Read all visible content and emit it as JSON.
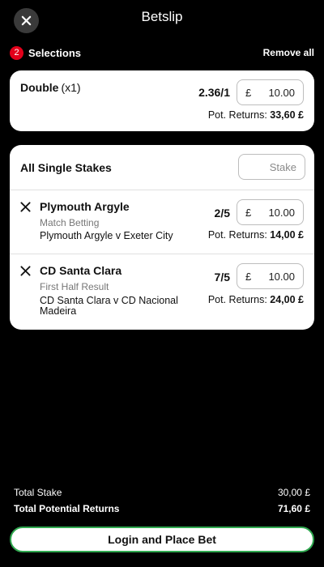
{
  "header": {
    "title": "Betslip",
    "close_icon": "close-icon"
  },
  "selections_bar": {
    "count": "2",
    "label": "Selections",
    "remove_all": "Remove all"
  },
  "double": {
    "label": "Double",
    "multiplier": "(x1)",
    "odds": "2.36/1",
    "currency": "£",
    "stake": "10.00",
    "returns_label": "Pot. Returns:",
    "returns_value": "33,60 £"
  },
  "singles": {
    "all_label": "All Single Stakes",
    "stake_placeholder": "Stake",
    "items": [
      {
        "team": "Plymouth Argyle",
        "market": "Match Betting",
        "event": "Plymouth Argyle v Exeter City",
        "odds": "2/5",
        "currency": "£",
        "stake": "10.00",
        "returns_label": "Pot. Returns:",
        "returns_value": "14,00 £"
      },
      {
        "team": "CD Santa Clara",
        "market": "First Half Result",
        "event": "CD Santa Clara v CD Nacional Madeira",
        "odds": "7/5",
        "currency": "£",
        "stake": "10.00",
        "returns_label": "Pot. Returns:",
        "returns_value": "24,00 £"
      }
    ]
  },
  "totals": {
    "stake_label": "Total Stake",
    "stake_value": "30,00 £",
    "returns_label": "Total Potential Returns",
    "returns_value": "71,60 £"
  },
  "cta": {
    "label": "Login and Place Bet"
  },
  "colors": {
    "background": "#000000",
    "badge": "#e2001a",
    "cta_border": "#2fa84f",
    "card": "#ffffff"
  }
}
